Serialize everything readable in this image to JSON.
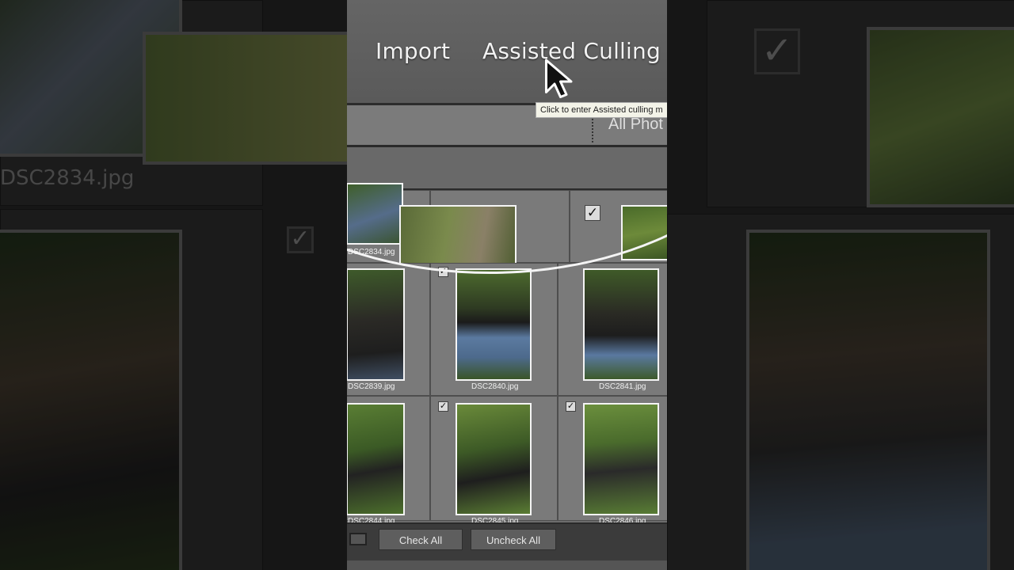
{
  "menu": {
    "import": "Import",
    "assisted_culling": "Assisted Culling"
  },
  "tooltip": "Click to enter Assisted culling m",
  "filter": {
    "label": "All Phot"
  },
  "grid": {
    "top_row": [
      {
        "file": "DSC2834.jpg",
        "checked": false
      },
      {
        "file": "",
        "checked": false
      },
      {
        "file": "",
        "checked": true
      }
    ],
    "row2": [
      {
        "file": "DSC2839.jpg",
        "checked": false
      },
      {
        "file": "DSC2840.jpg",
        "checked": true
      },
      {
        "file": "DSC2841.jpg",
        "checked": false
      }
    ],
    "row3": [
      {
        "file": "DSC2844.jpg",
        "checked": false
      },
      {
        "file": "DSC2845.jpg",
        "checked": true
      },
      {
        "file": "DSC2846.jpg",
        "checked": true
      }
    ]
  },
  "buttons": {
    "check_all": "Check All",
    "uncheck_all": "Uncheck All"
  },
  "side": {
    "left_label": "DSC2834.jpg"
  },
  "colors": {
    "panel": "#6d6d6d",
    "thumb_border": "#f4f4f4",
    "foliage": "#3e5a2a"
  }
}
